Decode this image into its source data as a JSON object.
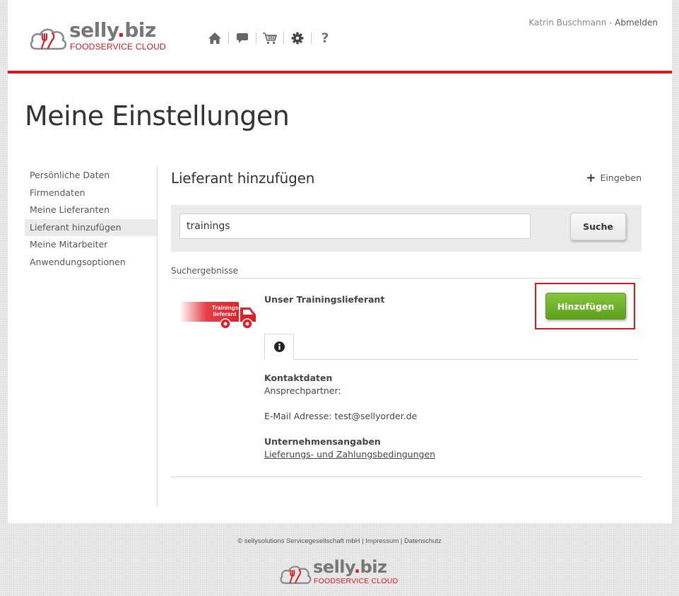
{
  "brand": {
    "name_main": "selly",
    "name_dot": ".",
    "name_tld": "biz",
    "tagline": "FOODSERVICE CLOUD",
    "accent_color": "#d9161c"
  },
  "topnav": {
    "items": [
      {
        "icon": "home-icon"
      },
      {
        "icon": "chat-icon"
      },
      {
        "icon": "cart-icon"
      },
      {
        "icon": "gear-icon"
      },
      {
        "icon": "help-icon"
      }
    ]
  },
  "user": {
    "name": "Katrin Buschmann",
    "separator": " - ",
    "logout_label": "Abmelden"
  },
  "page_title": "Meine Einstellungen",
  "sidebar": {
    "items": [
      {
        "label": "Persönliche Daten",
        "active": false
      },
      {
        "label": "Firmendaten",
        "active": false
      },
      {
        "label": "Meine Lieferanten",
        "active": false
      },
      {
        "label": "Lieferant hinzufügen",
        "active": true
      },
      {
        "label": "Meine Mitarbeiter",
        "active": false
      },
      {
        "label": "Anwendungsoptionen",
        "active": false
      }
    ]
  },
  "main": {
    "section_title": "Lieferant hinzufügen",
    "enter_label": "Eingeben",
    "search": {
      "value": "trainings",
      "placeholder": "",
      "button_label": "Suche"
    },
    "results_label": "Suchergebnisse",
    "result": {
      "truck_text_line1": "Trainings-",
      "truck_text_line2": "lieferant",
      "name": "Unser Trainingslieferant",
      "add_button_label": "Hinzufügen",
      "add_button_color": "#6cb02a",
      "info_tab_icon": "info-icon",
      "contact_heading": "Kontaktdaten",
      "contact_person_label": "Ansprechpartner:",
      "email_line": "E-Mail Adresse: test@sellyorder.de",
      "company_heading": "Unternehmensangaben",
      "terms_link": "Lieferungs- und Zahlungsbedingungen"
    }
  },
  "footer": {
    "copyright": "© sellysolutions Servicegesellschaft mbH",
    "divider": " | ",
    "impressum": "Impressum",
    "datenschutz": "Datenschutz"
  }
}
